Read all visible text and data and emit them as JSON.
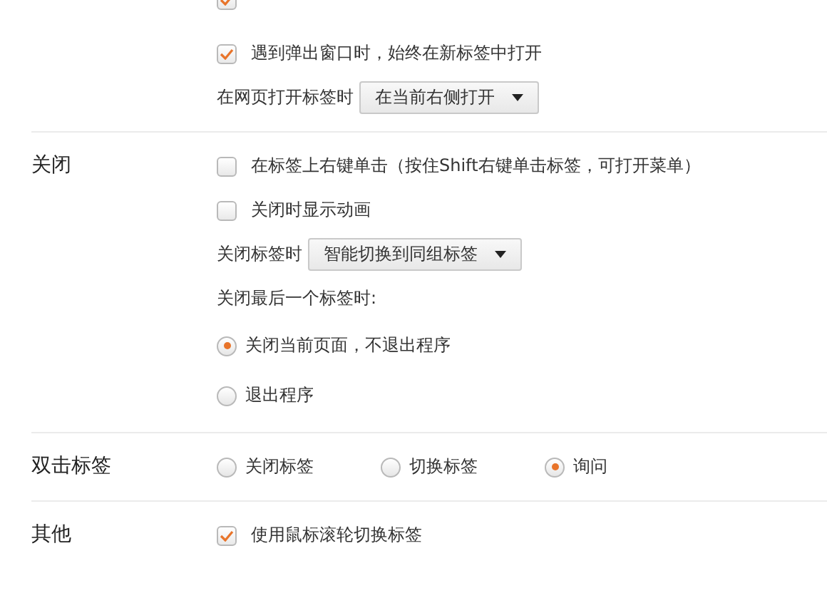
{
  "top_partial": {
    "checked": true
  },
  "sections": [
    {
      "rows": [
        {
          "kind": "checkbox",
          "label": "遇到弹出窗口时，始终在新标签中打开",
          "checked": true
        },
        {
          "kind": "select",
          "label": "在网页打开标签时",
          "value": "在当前右侧打开"
        }
      ]
    },
    {
      "title": "关闭",
      "rows": [
        {
          "kind": "checkbox",
          "label": "在标签上右键单击（按住Shift右键单击标签，可打开菜单）",
          "checked": false
        },
        {
          "kind": "checkbox",
          "label": "关闭时显示动画",
          "checked": false
        },
        {
          "kind": "select",
          "label": "关闭标签时",
          "value": "智能切换到同组标签"
        },
        {
          "kind": "text",
          "label": "关闭最后一个标签时:"
        },
        {
          "kind": "radio",
          "label": "关闭当前页面，不退出程序",
          "selected": true
        },
        {
          "kind": "radio",
          "label": "退出程序",
          "selected": false
        }
      ]
    },
    {
      "title": "双击标签",
      "rows": [
        {
          "kind": "radios",
          "options": [
            {
              "label": "关闭标签",
              "selected": false
            },
            {
              "label": "切换标签",
              "selected": false
            },
            {
              "label": "询问",
              "selected": true
            }
          ]
        }
      ]
    },
    {
      "title": "其他",
      "rows": [
        {
          "kind": "checkbox",
          "label": "使用鼠标滚轮切换标签",
          "checked": true
        }
      ]
    }
  ]
}
